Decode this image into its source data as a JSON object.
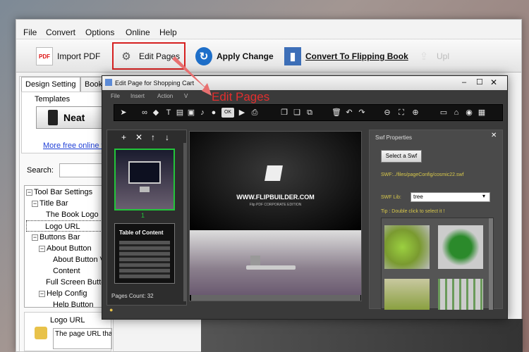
{
  "menu": [
    "File",
    "Convert",
    "Options",
    "Online",
    "Help"
  ],
  "toolbar": {
    "import_pdf": "Import PDF",
    "edit_pages": "Edit Pages",
    "apply_change": "Apply Change",
    "convert": "Convert To Flipping Book",
    "upload_partial": "Upl"
  },
  "tabs": {
    "design_setting": "Design Setting",
    "bookmark_partial": "Bookm"
  },
  "templates": {
    "label": "Templates",
    "current": "Neat",
    "more_link": "More free online t"
  },
  "search": {
    "label": "Search:",
    "value": ""
  },
  "tree": [
    "Tool Bar Settings",
    "Title Bar",
    "The Book Logo",
    "Logo URL",
    "Buttons Bar",
    "About Button",
    "About Button V",
    "Content",
    "Full Screen Butto",
    "Help Config",
    "Help Button"
  ],
  "desc": {
    "title": "Logo URL",
    "text": "The page URL that will open when"
  },
  "editor": {
    "title": "Edit Page for Shopping Cart",
    "menu": [
      "File",
      "Insert",
      "Action",
      "V"
    ],
    "thumb_number": "1",
    "thumb2_title": "Table of Content",
    "pages_count": "Pages Count: 32",
    "book_site": "WWW.FLIPBUILDER.COM",
    "book_edition": "Flip PDF CORPORATE EDITION"
  },
  "swf": {
    "title": "Swf Properties",
    "select_button": "Select a Swf",
    "path": "SWF:../files/pageConfig/cosmic22.swf",
    "lib_label": "SWF Lib:",
    "lib_value": "tree",
    "tip": "Tip : Double click to select it !"
  },
  "annotation": "Edit Pages",
  "colors": {
    "accent_red": "#e32e2e",
    "link_blue": "#1f3fd6",
    "swf_yellow": "#d8c84a",
    "thumb_green": "#22c53a"
  }
}
